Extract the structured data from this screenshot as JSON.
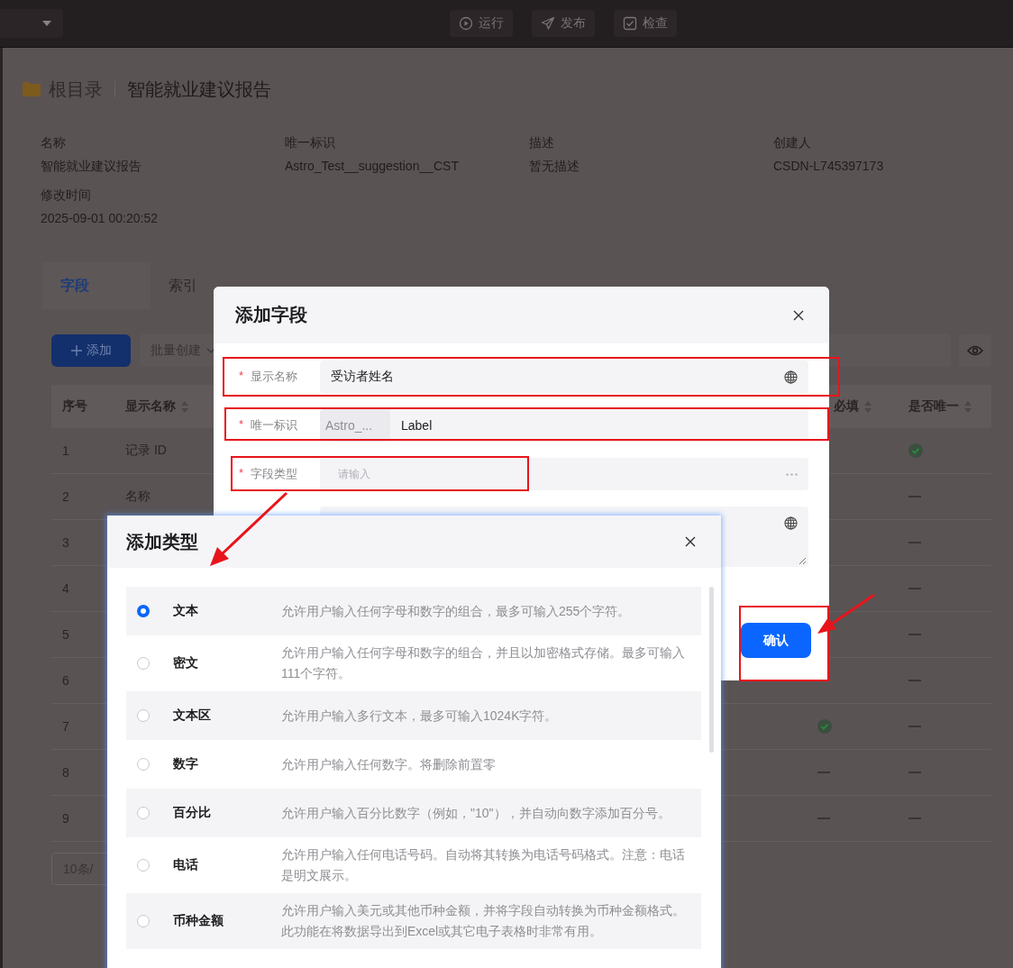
{
  "top_bar": {
    "actions": [
      {
        "label": "运行"
      },
      {
        "label": "发布"
      },
      {
        "label": "检查"
      }
    ]
  },
  "breadcrumb": {
    "root": "根目录",
    "current": "智能就业建议报告"
  },
  "info": [
    {
      "label": "名称",
      "value": "智能就业建议报告"
    },
    {
      "label": "唯一标识",
      "value": "Astro_Test__suggestion__CST"
    },
    {
      "label": "描述",
      "value": "暂无描述"
    },
    {
      "label": "创建人",
      "value": "CSDN-L745397173"
    },
    {
      "label": "修改时间",
      "value": "2025-09-01 00:20:52"
    }
  ],
  "tabs": [
    {
      "label": "字段",
      "selected": true
    },
    {
      "label": "索引",
      "selected": false
    }
  ],
  "toolbar": {
    "add": "添加",
    "batch": "批量创建"
  },
  "table": {
    "columns": [
      {
        "label": "序号",
        "sortable": false
      },
      {
        "label": "显示名称",
        "sortable": true
      },
      {
        "label": "必填",
        "sortable": true
      },
      {
        "label": "是否唯一",
        "sortable": true
      }
    ],
    "rows": [
      {
        "index": "1",
        "name": "记录 ID",
        "unique": true
      },
      {
        "index": "2",
        "name": "名称",
        "unique": false
      },
      {
        "index": "3",
        "unique": false
      },
      {
        "index": "4",
        "unique": false
      },
      {
        "index": "5",
        "unique": false
      },
      {
        "index": "6",
        "unique": false
      },
      {
        "index": "7",
        "required": true,
        "unique": false
      },
      {
        "index": "8",
        "required": false,
        "unique": false
      },
      {
        "index": "9",
        "required": false,
        "unique": false
      }
    ]
  },
  "pagination": {
    "page_size": "10条/"
  },
  "field_dialog": {
    "title": "添加字段",
    "fields": [
      {
        "kind": "i18n",
        "required_mark": "*",
        "label": "显示名称",
        "value": "受访者姓名"
      },
      {
        "kind": "prefixed",
        "required_mark": "*",
        "label": "唯一标识",
        "prefix": "Astro_...",
        "value": "Label"
      },
      {
        "kind": "picker",
        "required_mark": "*",
        "label": "字段类型",
        "placeholder": "请输入"
      },
      {
        "kind": "textarea"
      }
    ],
    "confirm": "确认"
  },
  "type_dialog": {
    "title": "添加类型",
    "options": [
      {
        "name": "文本",
        "description": "允许用户输入任何字母和数字的组合，最多可输入255个字符。",
        "selected": true
      },
      {
        "name": "密文",
        "description": "允许用户输入任何字母和数字的组合，并且以加密格式存储。最多可输入111个字符。",
        "selected": false
      },
      {
        "name": "文本区",
        "description": "允许用户输入多行文本，最多可输入1024K字符。",
        "selected": false
      },
      {
        "name": "数字",
        "description": "允许用户输入任何数字。将删除前置零",
        "selected": false
      },
      {
        "name": "百分比",
        "description": "允许用户输入百分比数字（例如，\"10\"），并自动向数字添加百分号。",
        "selected": false
      },
      {
        "name": "电话",
        "description": "允许用户输入任何电话号码。自动将其转换为电话号码格式。注意：电话是明文展示。",
        "selected": false
      },
      {
        "name": "币种金额",
        "description": "允许用户输入美元或其他币种金额，并将字段自动转换为币种金额格式。此功能在将数据导出到Excel或其它电子表格时非常有用。",
        "selected": false
      }
    ]
  }
}
